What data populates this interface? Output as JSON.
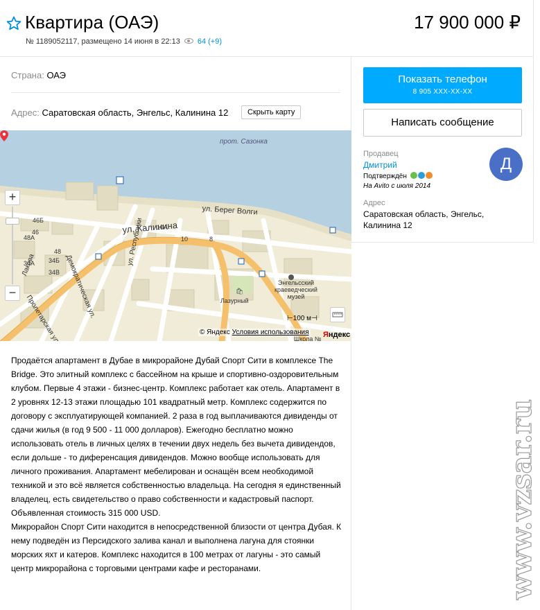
{
  "header": {
    "title": "Квартира (ОАЭ)",
    "price": "17 900 000 ₽",
    "meta": "№ 1189052117, размещено 14 июня в 22:13",
    "views": "64 (+9)"
  },
  "details": {
    "country_label": "Страна:",
    "country_value": "ОАЭ",
    "address_label": "Адрес:",
    "address_value": "Саратовская область, Энгельс, Калинина 12",
    "hide_map_label": "Скрыть карту"
  },
  "map": {
    "labels": {
      "street_kalinina": "ул. Калинина",
      "street_bereg_volgi": "ул. Берег Волги",
      "street_sazonka": "прот. Сазонка",
      "street_demokraticheskaya": "Демократическая ул.",
      "street_respubliki": "ул. Республики",
      "street_proletarskaya": "Пролетарская ул.",
      "street_lakova": "Лакова",
      "museum": "Энгельсский краеведческий музей",
      "lazurny": "Лазурный",
      "shkola": "Школа №"
    },
    "house_numbers": [
      "46Б",
      "46",
      "48А",
      "48",
      "34Б",
      "34А",
      "34В",
      "10А",
      "10",
      "8"
    ],
    "scale": "100 м",
    "copyright": "© Яндекс",
    "terms": "Условия использования",
    "logo_part1": "Я",
    "logo_part2": "ндекс",
    "zoom_in": "+",
    "zoom_out": "−",
    "pin_color": "#e8323c",
    "water_color": "#b5d0e1",
    "road_color": "#f5c06b"
  },
  "description": [
    "Продаётся апартамент в Дубае в микрорайоне Дубай Спорт Сити в комплексе The Bridge. Это элитный комплекс с бассейном на крыше и спортивно-оздоровительным клубом. Первые 4 этажи - бизнес-центр. Комплекс работает как отель. Апартамент в 2 уровнях 12-13 этажи площадью 101 квадратный метр. Комплекс содержится по договору с эксплуатирующей компанией. 2 раза в год выплачиваются дивиденды от сдачи жилья (в год 9 500 - 11 000 долларов). Ежегодно бесплатно можно использовать отель в личных целях в течении двух недель без вычета дивидендов, если дольше - то диференсация дивидендов. Можно вообще использовать для личного проживания. Апартамент мебелирован и оснащён всем необходимой техникой и это всё является собственностью владельца. На сегодня я единственный владелец, есть свидетельство о право собственности и кадастровый паспорт. Объявленная стоимость 315 000 USD.",
    "Микрорайон Спорт Сити находится в непосредственной близости от центра Дубая. К нему подведён из Персидского залива канал и выполнена лагуна для стоянки морских яхт и катеров. Комплекс находится в 100 метрах от лагуны - это самый центр микрорайона с торговыми центрами кафе и ресторанами."
  ],
  "sidebar": {
    "phone_button": "Показать телефон",
    "phone_number": "8 905 XXX-XX-XX",
    "message_button": "Написать сообщение",
    "seller_label": "Продавец",
    "seller_name": "Дмитрий",
    "confirmed": "Подтверждён",
    "since": "На Avito с июля 2014",
    "avatar_letter": "Д",
    "address_label": "Адрес",
    "address_value": "Саратовская область, Энгельс, Калинина 12",
    "accent_color": "#00aaff",
    "avatar_color": "#4a6fc7"
  },
  "watermark": "www.vzsar.ru"
}
